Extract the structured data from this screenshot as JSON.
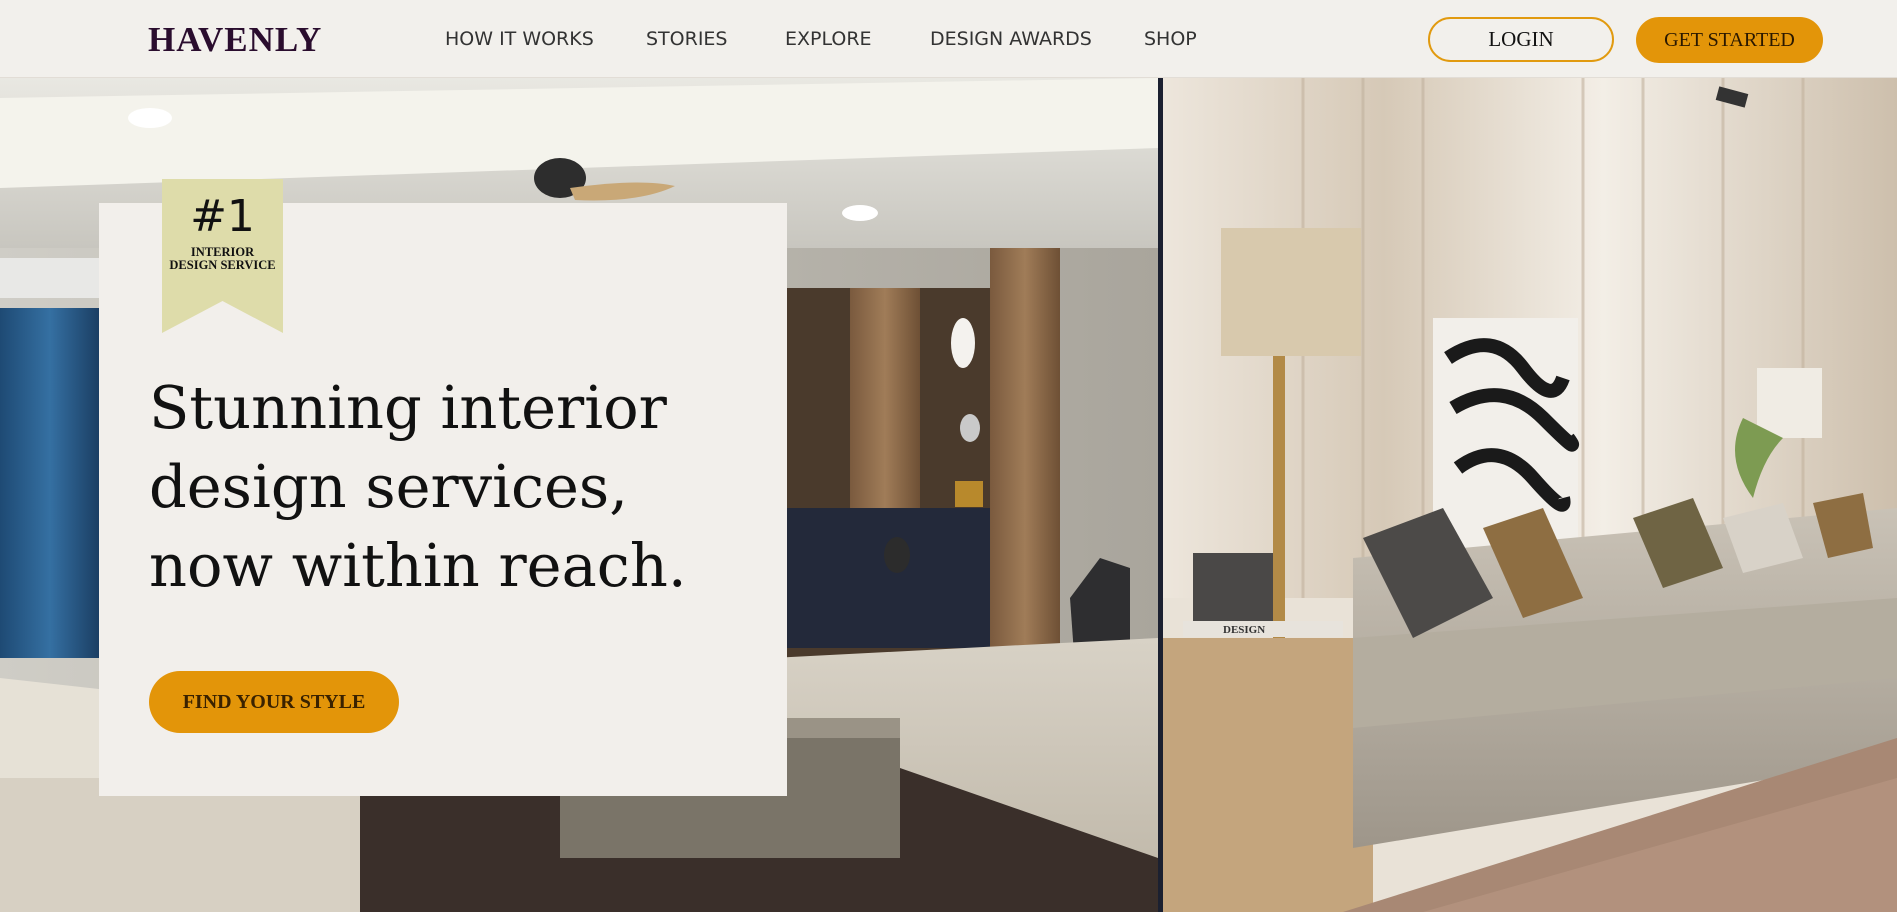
{
  "brand": {
    "logo": "HAVENLY"
  },
  "nav": {
    "items": [
      {
        "label": "HOW IT WORKS"
      },
      {
        "label": "STORIES"
      },
      {
        "label": "EXPLORE"
      },
      {
        "label": "DESIGN AWARDS"
      },
      {
        "label": "SHOP"
      }
    ]
  },
  "auth": {
    "login_label": "LOGIN",
    "get_started_label": "GET STARTED"
  },
  "hero": {
    "badge_number": "#1",
    "badge_line1": "INTERIOR",
    "badge_line2": "DESIGN SERVICE",
    "headline": "Stunning interior design services, now within reach.",
    "cta_label": "FIND YOUR STYLE",
    "book_label": "DESIGN"
  },
  "colors": {
    "accent": "#e39509",
    "logo": "#2a0d2e",
    "background": "#f2efeb",
    "badge": "#dedcaa"
  }
}
